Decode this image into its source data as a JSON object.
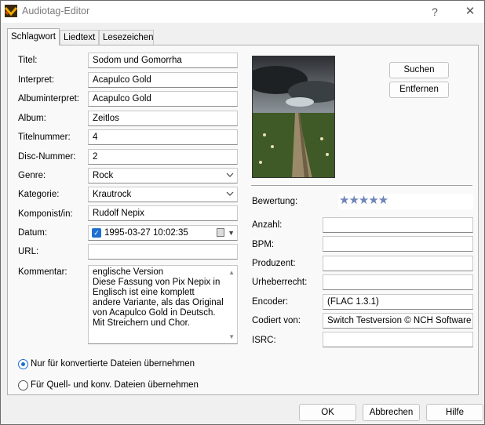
{
  "window": {
    "title": "Audiotag-Editor",
    "help_glyph": "?",
    "close_glyph": "✕"
  },
  "tabs": [
    {
      "label": "Schlagwort",
      "active": true
    },
    {
      "label": "Liedtext",
      "active": false
    },
    {
      "label": "Lesezeichen",
      "active": false
    }
  ],
  "fields": {
    "titel": {
      "label": "Titel:",
      "value": "Sodom und Gomorrha"
    },
    "interpret": {
      "label": "Interpret:",
      "value": "Acapulco Gold"
    },
    "albuminterpret": {
      "label": "Albuminterpret:",
      "value": "Acapulco Gold"
    },
    "album": {
      "label": "Album:",
      "value": "Zeitlos"
    },
    "titelnummer": {
      "label": "Titelnummer:",
      "value": "4"
    },
    "disc_nummer": {
      "label": "Disc-Nummer:",
      "value": "2"
    },
    "genre": {
      "label": "Genre:",
      "value": "Rock"
    },
    "kategorie": {
      "label": "Kategorie:",
      "value": "Krautrock"
    },
    "komponist": {
      "label": "Komponist/in:",
      "value": "Rudolf Nepix"
    },
    "datum": {
      "label": "Datum:",
      "value": "1995-03-27 10:02:35",
      "checked": true
    },
    "url": {
      "label": "URL:",
      "value": ""
    },
    "kommentar": {
      "label": "Kommentar:",
      "value": "englische Version\nDiese Fassung von Pix Nepix in Englisch ist eine komplett andere Variante, als das Original von Acapulco Gold in Deutsch. Mit Streichern und Chor."
    }
  },
  "cover_buttons": {
    "search": "Suchen",
    "remove": "Entfernen"
  },
  "right_fields": {
    "bewertung": {
      "label": "Bewertung:",
      "stars": "★★★★★",
      "rating": 5
    },
    "anzahl": {
      "label": "Anzahl:",
      "value": ""
    },
    "bpm": {
      "label": "BPM:",
      "value": ""
    },
    "produzent": {
      "label": "Produzent:",
      "value": ""
    },
    "urheberrecht": {
      "label": "Urheberrecht:",
      "value": ""
    },
    "encoder": {
      "label": "Encoder:",
      "value": "(FLAC 1.3.1)"
    },
    "codiert_von": {
      "label": "Codiert von:",
      "value": "Switch Testversion © NCH Software"
    },
    "isrc": {
      "label": "ISRC:",
      "value": ""
    }
  },
  "radios": {
    "converted_only": {
      "label": "Nur für konvertierte Dateien übernehmen",
      "checked": true
    },
    "source_and_converted": {
      "label": "Für Quell- und konv. Dateien übernehmen",
      "checked": false
    }
  },
  "footer": {
    "ok": "OK",
    "cancel": "Abbrechen",
    "help": "Hilfe"
  },
  "colors": {
    "accent": "#1e6fd0",
    "stars": "#6f84b8"
  }
}
